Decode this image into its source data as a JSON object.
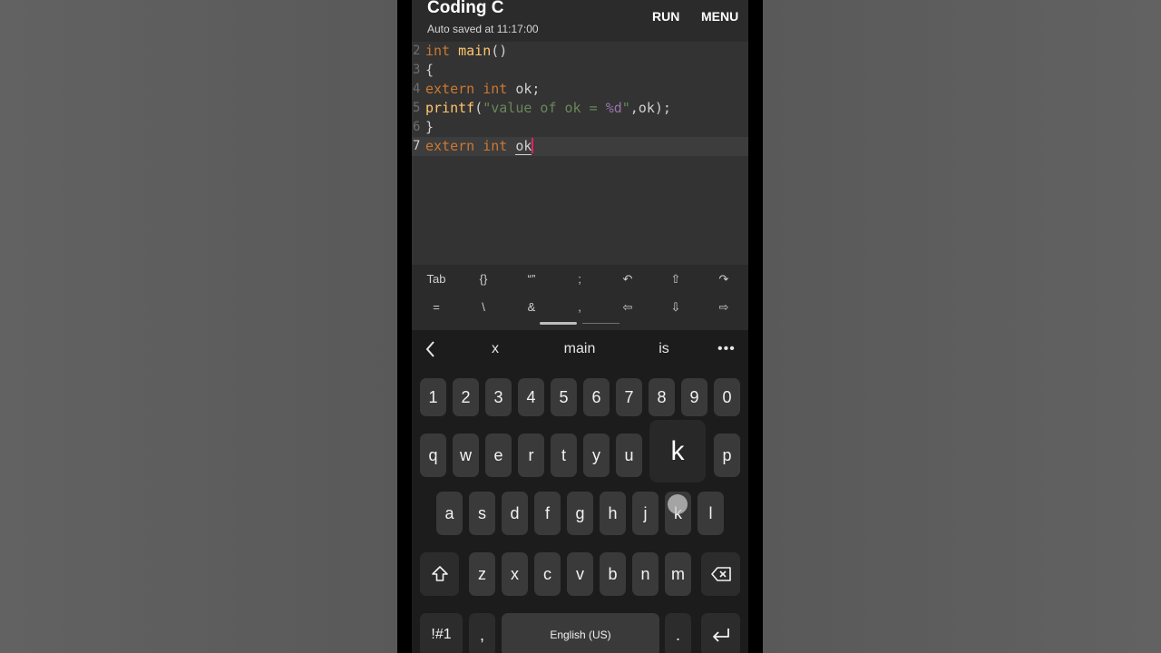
{
  "app": {
    "title": "Coding C",
    "autosave": "Auto saved at 11:17:00",
    "run_label": "RUN",
    "menu_label": "MENU"
  },
  "editor": {
    "lines": [
      {
        "num": "2",
        "tokens": [
          [
            "kw",
            "int "
          ],
          [
            "fn",
            "main"
          ],
          [
            "pl",
            "()"
          ]
        ]
      },
      {
        "num": "3",
        "tokens": [
          [
            "pl",
            "{"
          ]
        ]
      },
      {
        "num": "4",
        "tokens": [
          [
            "kw",
            "extern int "
          ],
          [
            "pl",
            "ok;"
          ]
        ]
      },
      {
        "num": "5",
        "tokens": [
          [
            "fn",
            "printf"
          ],
          [
            "pl",
            "("
          ],
          [
            "str",
            "\"value of ok = "
          ],
          [
            "fmt",
            "%d"
          ],
          [
            "str",
            "\""
          ],
          [
            "pl",
            ",ok);"
          ]
        ]
      },
      {
        "num": "6",
        "tokens": [
          [
            "pl",
            "}"
          ]
        ]
      },
      {
        "num": "7",
        "tokens": [
          [
            "kw",
            "extern int "
          ],
          [
            "pl",
            "ok"
          ]
        ]
      }
    ],
    "active_line": "7"
  },
  "extra_keys": {
    "row1": [
      "Tab",
      "{}",
      "“”",
      ";",
      "↶",
      "⇧",
      "↷"
    ],
    "row2": [
      "=",
      "\\",
      "&",
      ",",
      "⇦",
      "⇩",
      "⇨"
    ]
  },
  "suggestions": {
    "back_icon": "chevron-left-icon",
    "items": [
      "x",
      "main",
      "is"
    ],
    "more": "•••"
  },
  "keyboard": {
    "row_numbers": [
      "1",
      "2",
      "3",
      "4",
      "5",
      "6",
      "7",
      "8",
      "9",
      "0"
    ],
    "row_top": [
      "q",
      "w",
      "e",
      "r",
      "t",
      "y",
      "u",
      "k",
      "p"
    ],
    "row_middle": [
      "a",
      "s",
      "d",
      "f",
      "g",
      "h",
      "j",
      "k",
      "l"
    ],
    "row_bottom": [
      "z",
      "x",
      "c",
      "v",
      "b",
      "n",
      "m"
    ],
    "shift_icon": "shift-icon",
    "backspace_icon": "backspace-icon",
    "symbols": "!#1",
    "comma": ",",
    "space": "English (US)",
    "period": ".",
    "enter_icon": "enter-icon",
    "popup_letter": "k"
  },
  "colors": {
    "keyword": "#cc7832",
    "function": "#ffc66d",
    "string": "#6a8759",
    "format_spec": "#9876aa",
    "cursor": "#e0245e"
  }
}
